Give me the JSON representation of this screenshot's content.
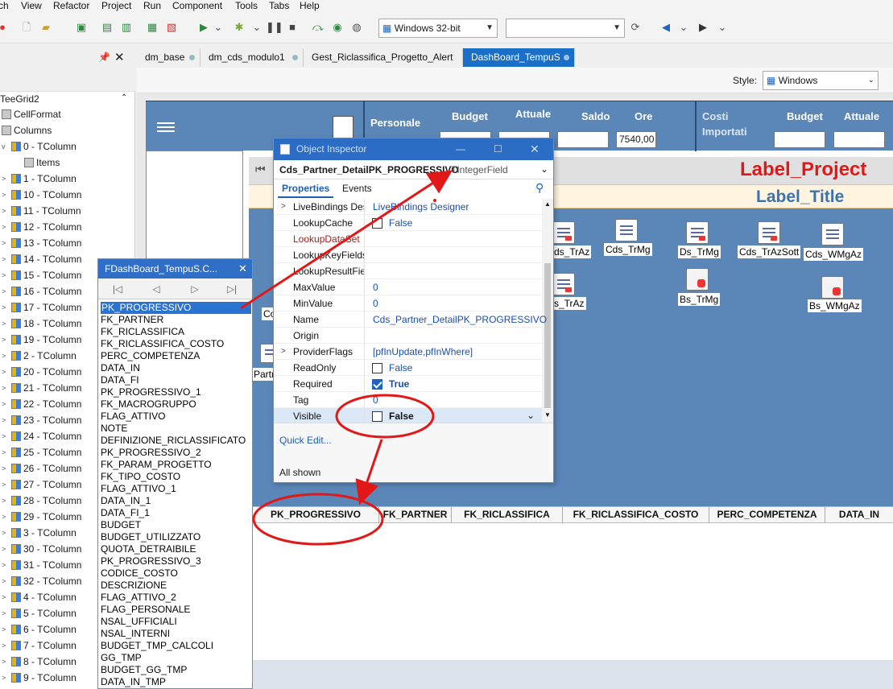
{
  "menu": [
    "ch",
    "View",
    "Refactor",
    "Project",
    "Run",
    "Component",
    "Tools",
    "Tabs",
    "Help"
  ],
  "toolbar": {
    "platform": "Windows 32-bit",
    "empty_combo": ""
  },
  "left_panel": {
    "root": "TeeGrid2",
    "items": [
      {
        "label": "CellFormat",
        "level": 0,
        "expander": ""
      },
      {
        "label": "Columns",
        "level": 0,
        "expander": ""
      },
      {
        "label": "0 - TColumn",
        "level": 1,
        "expander": "v"
      },
      {
        "label": "Items",
        "level": 2,
        "expander": ""
      },
      {
        "label": "1 - TColumn",
        "level": 1,
        "expander": ">"
      },
      {
        "label": "10 - TColumn",
        "level": 1,
        "expander": ">"
      },
      {
        "label": "11 - TColumn",
        "level": 1,
        "expander": ">"
      },
      {
        "label": "12 - TColumn",
        "level": 1,
        "expander": ">"
      },
      {
        "label": "13 - TColumn",
        "level": 1,
        "expander": ">"
      },
      {
        "label": "14 - TColumn",
        "level": 1,
        "expander": ">"
      },
      {
        "label": "15 - TColumn",
        "level": 1,
        "expander": ">"
      },
      {
        "label": "16 - TColumn",
        "level": 1,
        "expander": ">"
      },
      {
        "label": "17 - TColumn",
        "level": 1,
        "expander": ">"
      },
      {
        "label": "18 - TColumn",
        "level": 1,
        "expander": ">"
      },
      {
        "label": "19 - TColumn",
        "level": 1,
        "expander": ">"
      },
      {
        "label": "2 - TColumn",
        "level": 1,
        "expander": ">"
      },
      {
        "label": "20 - TColumn",
        "level": 1,
        "expander": ">"
      },
      {
        "label": "21 - TColumn",
        "level": 1,
        "expander": ">"
      },
      {
        "label": "22 - TColumn",
        "level": 1,
        "expander": ">"
      },
      {
        "label": "23 - TColumn",
        "level": 1,
        "expander": ">"
      },
      {
        "label": "24 - TColumn",
        "level": 1,
        "expander": ">"
      },
      {
        "label": "25 - TColumn",
        "level": 1,
        "expander": ">"
      },
      {
        "label": "26 - TColumn",
        "level": 1,
        "expander": ">"
      },
      {
        "label": "27 - TColumn",
        "level": 1,
        "expander": ">"
      },
      {
        "label": "28 - TColumn",
        "level": 1,
        "expander": ">"
      },
      {
        "label": "29 - TColumn",
        "level": 1,
        "expander": ">"
      },
      {
        "label": "3 - TColumn",
        "level": 1,
        "expander": ">"
      },
      {
        "label": "30 - TColumn",
        "level": 1,
        "expander": ">"
      },
      {
        "label": "31 - TColumn",
        "level": 1,
        "expander": ">"
      },
      {
        "label": "32 - TColumn",
        "level": 1,
        "expander": ">"
      },
      {
        "label": "4 - TColumn",
        "level": 1,
        "expander": ">"
      },
      {
        "label": "5 - TColumn",
        "level": 1,
        "expander": ">"
      },
      {
        "label": "6 - TColumn",
        "level": 1,
        "expander": ">"
      },
      {
        "label": "7 - TColumn",
        "level": 1,
        "expander": ">"
      },
      {
        "label": "8 - TColumn",
        "level": 1,
        "expander": ">"
      },
      {
        "label": "9 - TColumn",
        "level": 1,
        "expander": ">"
      }
    ]
  },
  "tabs": [
    {
      "label": "dm_base",
      "active": false
    },
    {
      "label": "dm_cds_modulo1",
      "active": false
    },
    {
      "label": "Gest_Riclassifica_Progetto_Alert",
      "active": false
    },
    {
      "label": "DashBoard_TempuS",
      "active": true
    }
  ],
  "style_bar": {
    "label": "Style:",
    "value": "Windows"
  },
  "form_header": {
    "personale": "Personale",
    "budget": "Budget",
    "attuale": "Attuale",
    "saldo": "Saldo",
    "ore": "Ore",
    "ore_value": "7540,00",
    "costi": "Costi",
    "importati": "Importati",
    "budget2": "Budget",
    "attuale2": "Attuale"
  },
  "labels": {
    "project": "Label_Project",
    "title": "Label_Title"
  },
  "components": [
    "ds_TrAz",
    "Cds_TrMg",
    "Ds_TrMg",
    "Cds_TrAzSott",
    "Cds_WMgAz",
    "s_TrAz",
    "Bs_TrMg",
    "Bs_WMgAz",
    "Co",
    "Partn"
  ],
  "grid_columns": [
    "PK_PROGRESSIVO",
    "FK_PARTNER",
    "FK_RICLASSIFICA",
    "FK_RICLASSIFICA_COSTO",
    "PERC_COMPETENZA",
    "DATA_IN"
  ],
  "fields_dialog": {
    "title": "FDashBoard_TempuS.C...",
    "fields": [
      "PK_PROGRESSIVO",
      "FK_PARTNER",
      "FK_RICLASSIFICA",
      "FK_RICLASSIFICA_COSTO",
      "PERC_COMPETENZA",
      "DATA_IN",
      "DATA_FI",
      "PK_PROGRESSIVO_1",
      "FK_MACROGRUPPO",
      "FLAG_ATTIVO",
      "NOTE",
      "DEFINIZIONE_RICLASSIFICATO",
      "PK_PROGRESSIVO_2",
      "FK_PARAM_PROGETTO",
      "FK_TIPO_COSTO",
      "FLAG_ATTIVO_1",
      "DATA_IN_1",
      "DATA_FI_1",
      "BUDGET",
      "BUDGET_UTILIZZATO",
      "QUOTA_DETRAIBILE",
      "PK_PROGRESSIVO_3",
      "CODICE_COSTO",
      "DESCRIZIONE",
      "FLAG_ATTIVO_2",
      "FLAG_PERSONALE",
      "NSAL_UFFICIALI",
      "NSAL_INTERNI",
      "BUDGET_TMP_CALCOLI",
      "GG_TMP",
      "BUDGET_GG_TMP",
      "DATA_IN_TMP"
    ],
    "selected": 0
  },
  "object_inspector": {
    "title": "Object Inspector",
    "object_name": "Cds_Partner_DetailPK_PROGRESSIVO",
    "object_type": "TIntegerField",
    "tab_properties": "Properties",
    "tab_events": "Events",
    "quick_edit": "Quick Edit...",
    "all_shown": "All shown",
    "properties": [
      {
        "name": "LiveBindings Des",
        "value": "LiveBindings Designer",
        "type": "link",
        "expander": ">"
      },
      {
        "name": "LookupCache",
        "value": "False",
        "type": "check",
        "checked": false
      },
      {
        "name": "LookupDataSet",
        "value": "",
        "type": "text",
        "red": true
      },
      {
        "name": "LookupKeyFields",
        "value": "",
        "type": "text"
      },
      {
        "name": "LookupResultFie",
        "value": "",
        "type": "text"
      },
      {
        "name": "MaxValue",
        "value": "0",
        "type": "text"
      },
      {
        "name": "MinValue",
        "value": "0",
        "type": "text"
      },
      {
        "name": "Name",
        "value": "Cds_Partner_DetailPK_PROGRESSIVO",
        "type": "text"
      },
      {
        "name": "Origin",
        "value": "",
        "type": "text"
      },
      {
        "name": "ProviderFlags",
        "value": "[pfInUpdate,pfInWhere]",
        "type": "text",
        "expander": ">"
      },
      {
        "name": "ReadOnly",
        "value": "False",
        "type": "check",
        "checked": false
      },
      {
        "name": "Required",
        "value": "True",
        "type": "check",
        "checked": true,
        "bold": true
      },
      {
        "name": "Tag",
        "value": "0",
        "type": "text"
      },
      {
        "name": "Visible",
        "value": "False",
        "type": "check",
        "checked": false,
        "bold": true,
        "selected": true
      }
    ]
  }
}
